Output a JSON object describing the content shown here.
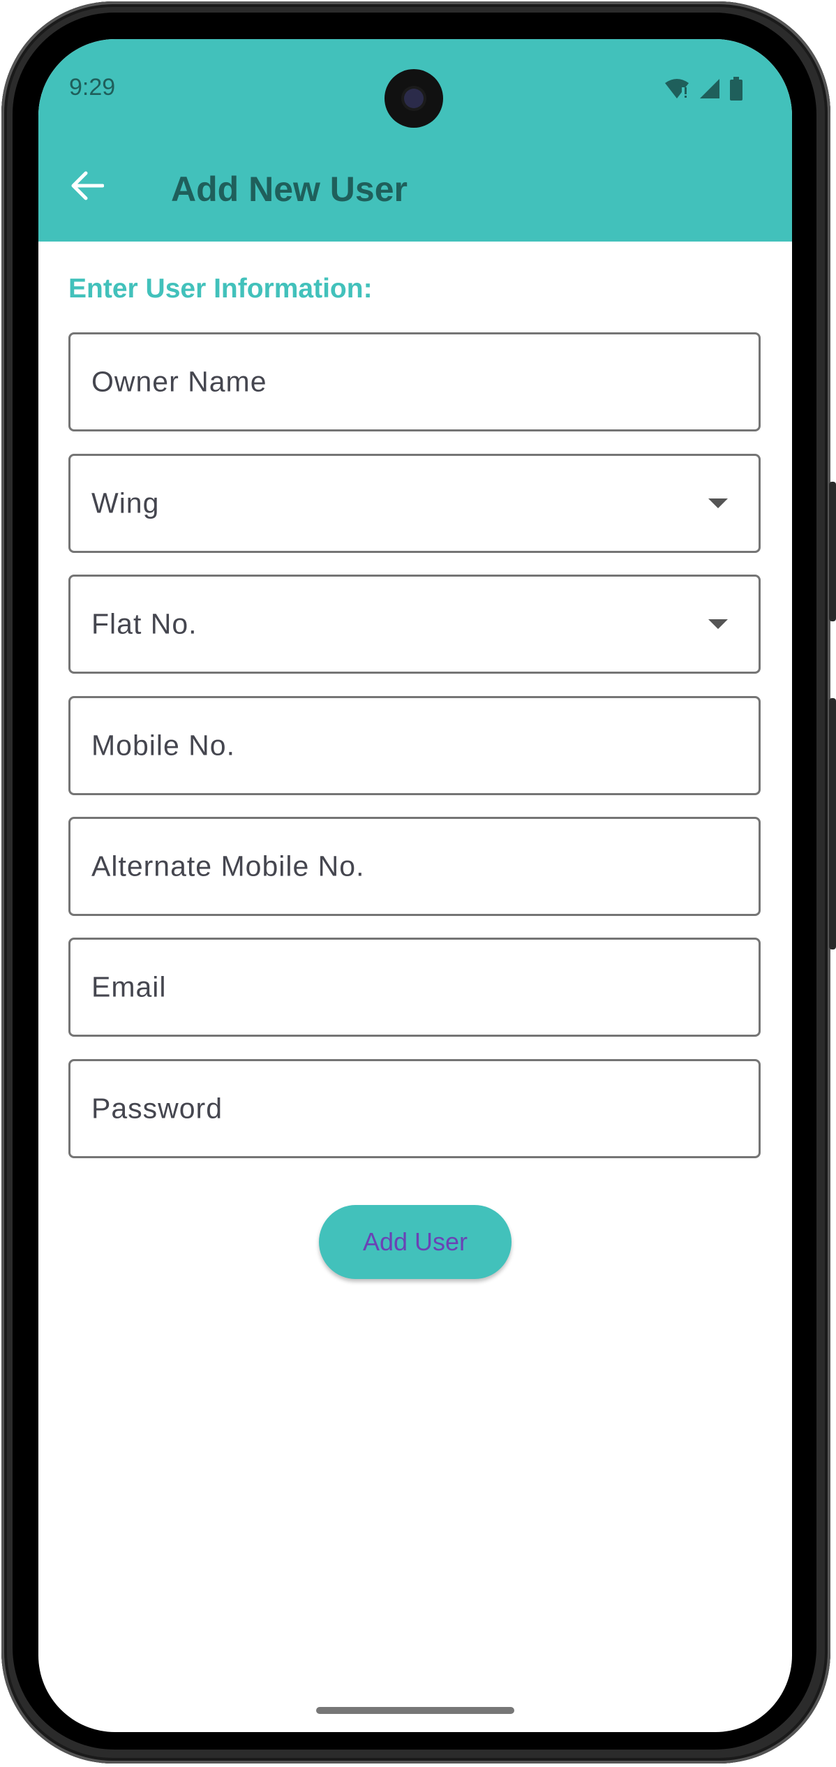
{
  "status_bar": {
    "time": "9:29"
  },
  "app_bar": {
    "title": "Add New User",
    "back_icon": "arrow-back-icon"
  },
  "form": {
    "section_label": "Enter User Information:",
    "fields": [
      {
        "label": "Owner Name",
        "type": "text"
      },
      {
        "label": "Wing",
        "type": "dropdown"
      },
      {
        "label": "Flat No.",
        "type": "dropdown"
      },
      {
        "label": "Mobile No.",
        "type": "text"
      },
      {
        "label": "Alternate Mobile No.",
        "type": "text"
      },
      {
        "label": "Email",
        "type": "text"
      },
      {
        "label": "Password",
        "type": "password"
      }
    ],
    "submit_label": "Add User"
  },
  "colors": {
    "primary": "#42c1bb",
    "title_text": "#1f5f5b",
    "button_text": "#6a43b5"
  }
}
